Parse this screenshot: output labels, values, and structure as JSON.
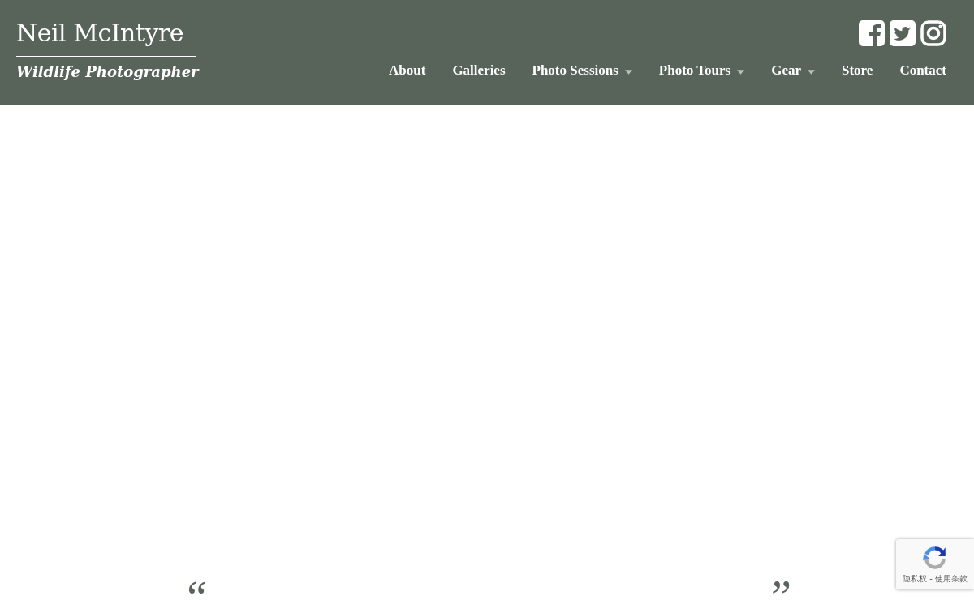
{
  "site": {
    "title": "Neil McIntyre",
    "tagline": "Wildlife Photographer"
  },
  "social": [
    {
      "kind": "facebook"
    },
    {
      "kind": "twitter"
    },
    {
      "kind": "instagram"
    }
  ],
  "nav": [
    {
      "label": "About",
      "dropdown": false
    },
    {
      "label": "Galleries",
      "dropdown": false
    },
    {
      "label": "Photo Sessions",
      "dropdown": true
    },
    {
      "label": "Photo Tours",
      "dropdown": true
    },
    {
      "label": "Gear",
      "dropdown": true
    },
    {
      "label": "Store",
      "dropdown": false
    },
    {
      "label": "Contact",
      "dropdown": false
    }
  ],
  "quote": {
    "open": "“",
    "close": "”"
  },
  "recaptcha": {
    "links": "隐私权 - 使用条款"
  }
}
